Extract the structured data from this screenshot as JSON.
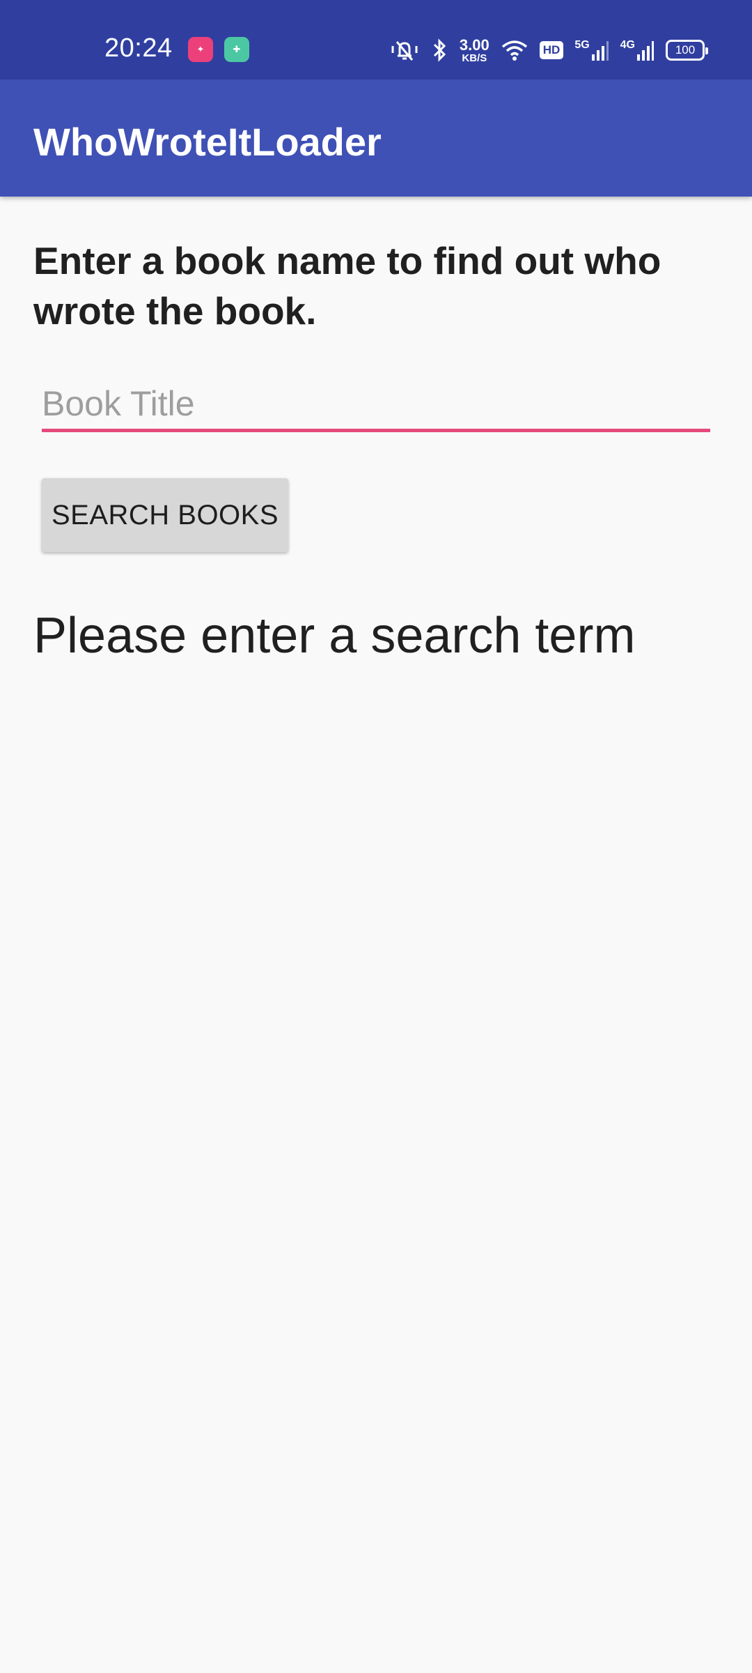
{
  "status_bar": {
    "time": "20:24",
    "app_icons": [
      "pink-app-icon",
      "green-app-icon"
    ],
    "net_speed_value": "3.00",
    "net_speed_unit": "KB/S",
    "hd_label": "HD",
    "signal_5g": "5G",
    "signal_4g": "4G",
    "battery": "100",
    "icons": [
      "mute-vibrate-icon",
      "bluetooth-icon",
      "wifi-icon",
      "signal-icon",
      "battery-icon"
    ]
  },
  "app_bar": {
    "title": "WhoWroteItLoader",
    "color": "#3f51b5"
  },
  "main": {
    "instructions": "Enter a book name to find out who wrote the book.",
    "book_input": {
      "placeholder": "Book Title",
      "value": ""
    },
    "search_button_label": "SEARCH BOOKS",
    "result_text": "Please enter a search term"
  },
  "colors": {
    "status_bar": "#303f9f",
    "app_bar": "#3f51b5",
    "accent": "#e64a7a",
    "background": "#f9f9fa"
  }
}
